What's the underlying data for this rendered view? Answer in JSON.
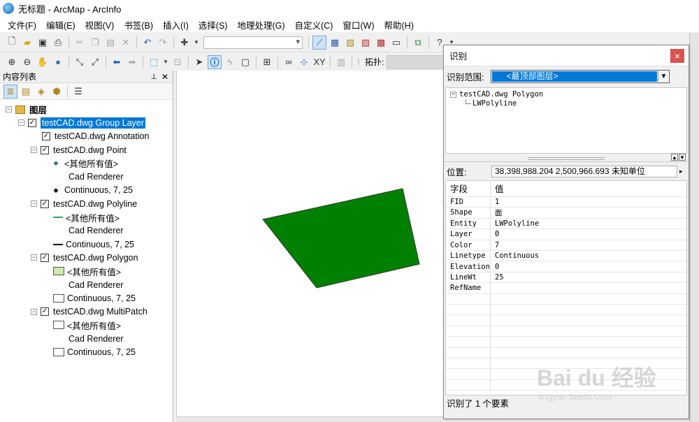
{
  "window": {
    "title": "无标题 - ArcMap - ArcInfo"
  },
  "menu": [
    "文件(F)",
    "编辑(E)",
    "视图(V)",
    "书签(B)",
    "插入(I)",
    "选择(S)",
    "地理处理(G)",
    "自定义(C)",
    "窗口(W)",
    "帮助(H)"
  ],
  "toolbar2": {
    "topology_label": "拓扑:"
  },
  "toc": {
    "title": "内容列表",
    "root": "图层",
    "group_layer": "testCAD.dwg Group Layer",
    "layers": [
      {
        "name": "testCAD.dwg Annotation",
        "checked": true,
        "expandable": false,
        "items": []
      },
      {
        "name": "testCAD.dwg Point",
        "checked": true,
        "expandable": true,
        "items": [
          {
            "sym": "point-teal",
            "label": "<其他所有值>"
          },
          {
            "sym": "",
            "label": "Cad Renderer"
          },
          {
            "sym": "point-black",
            "label": "Continuous, 7, 25"
          }
        ]
      },
      {
        "name": "testCAD.dwg Polyline",
        "checked": true,
        "expandable": true,
        "items": [
          {
            "sym": "line-green",
            "label": "<其他所有值>"
          },
          {
            "sym": "",
            "label": "Cad Renderer"
          },
          {
            "sym": "line-black",
            "label": "Continuous, 7, 25"
          }
        ]
      },
      {
        "name": "testCAD.dwg Polygon",
        "checked": true,
        "expandable": true,
        "items": [
          {
            "sym": "poly-green",
            "label": "<其他所有值>"
          },
          {
            "sym": "",
            "label": "Cad Renderer"
          },
          {
            "sym": "poly-white",
            "label": "Continuous, 7, 25"
          }
        ]
      },
      {
        "name": "testCAD.dwg MultiPatch",
        "checked": true,
        "expandable": true,
        "items": [
          {
            "sym": "poly-white",
            "label": "<其他所有值>"
          },
          {
            "sym": "",
            "label": "Cad Renderer"
          },
          {
            "sym": "poly-white",
            "label": "Continuous, 7, 25"
          }
        ]
      }
    ]
  },
  "map": {
    "polygon_fill": "#008000"
  },
  "identify": {
    "title": "识别",
    "close": "×",
    "scope_label": "识别范围:",
    "scope_value": "<最顶部图层>",
    "tree_parent": "testCAD.dwg Polygon",
    "tree_child": "LWPolyline",
    "location_label": "位置:",
    "location_value": "38,398,988.204  2,500,966.693 未知单位",
    "columns": {
      "field": "字段",
      "value": "值"
    },
    "rows": [
      {
        "field": "FID",
        "value": "1"
      },
      {
        "field": "Shape",
        "value": "面"
      },
      {
        "field": "Entity",
        "value": "LWPolyline"
      },
      {
        "field": "Layer",
        "value": "0"
      },
      {
        "field": "Color",
        "value": "7"
      },
      {
        "field": "Linetype",
        "value": "Continuous"
      },
      {
        "field": "Elevation",
        "value": "0"
      },
      {
        "field": "LineWt",
        "value": "25"
      },
      {
        "field": "RefName",
        "value": ""
      }
    ],
    "status": "识别了 1 个要素"
  },
  "watermark": {
    "brand": "Bai du 经验",
    "url": "jingyan.baidu.com"
  }
}
